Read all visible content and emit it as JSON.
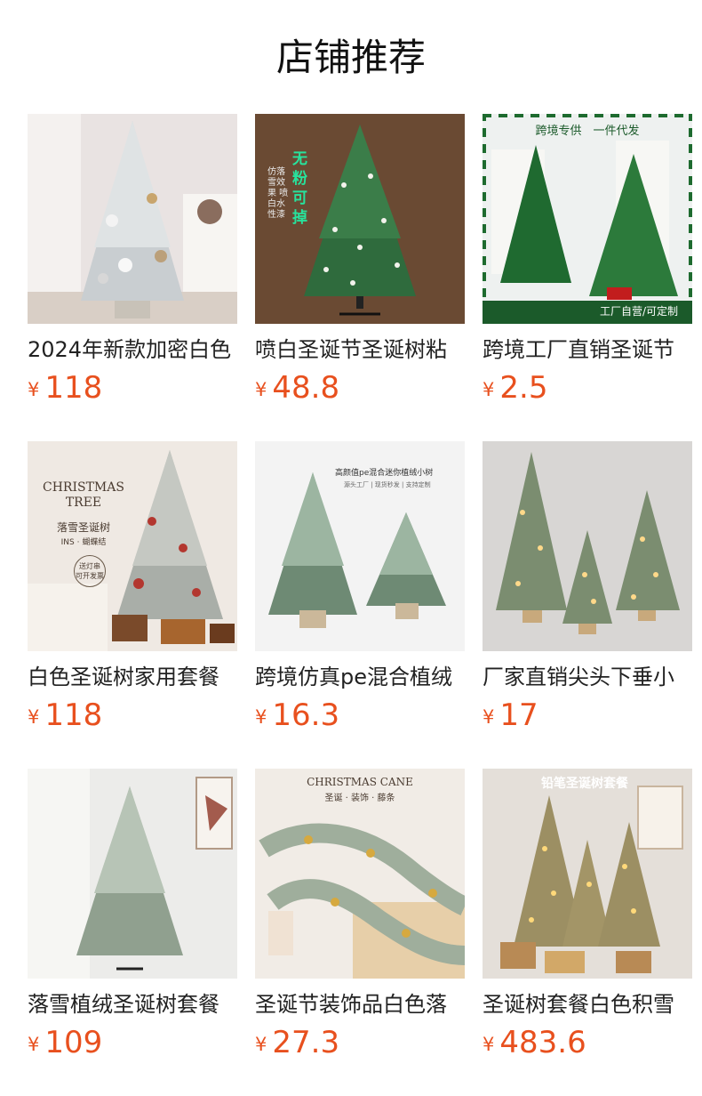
{
  "section_title": "店铺推荐",
  "currency_symbol": "¥",
  "products": [
    {
      "name": "2024年新款加密白色",
      "price": "118"
    },
    {
      "name": "喷白圣诞节圣诞树粘",
      "price": "48.8",
      "overlay": {
        "badge": "无粉可掉",
        "side": "仿落雪效果 喷白水性漆"
      }
    },
    {
      "name": "跨境工厂直销圣诞节",
      "price": "2.5",
      "overlay": {
        "top": "跨境专供　一件代发",
        "bottom": "工厂自营/可定制"
      }
    },
    {
      "name": "白色圣诞树家用套餐",
      "price": "118",
      "overlay": {
        "headline": "CHRISTMAS TREE",
        "sub": "落雪圣诞树",
        "tag": "INS · 蝴蝶结",
        "stamp": "送灯串 可开发票"
      }
    },
    {
      "name": "跨境仿真pe混合植绒",
      "price": "16.3",
      "overlay": {
        "top": "高颜值pe混合迷你植绒小树",
        "sub": "源头工厂 | 现货秒发 | 支持定制"
      }
    },
    {
      "name": "厂家直销尖头下垂小",
      "price": "17"
    },
    {
      "name": "落雪植绒圣诞树套餐",
      "price": "109"
    },
    {
      "name": "圣诞节装饰品白色落",
      "price": "27.3",
      "overlay": {
        "headline": "CHRISTMAS CANE",
        "sub": "圣诞 · 装饰 · 藤条"
      }
    },
    {
      "name": "圣诞树套餐白色积雪",
      "price": "483.6",
      "overlay": {
        "headline": "铅笔圣诞树套餐"
      }
    }
  ]
}
